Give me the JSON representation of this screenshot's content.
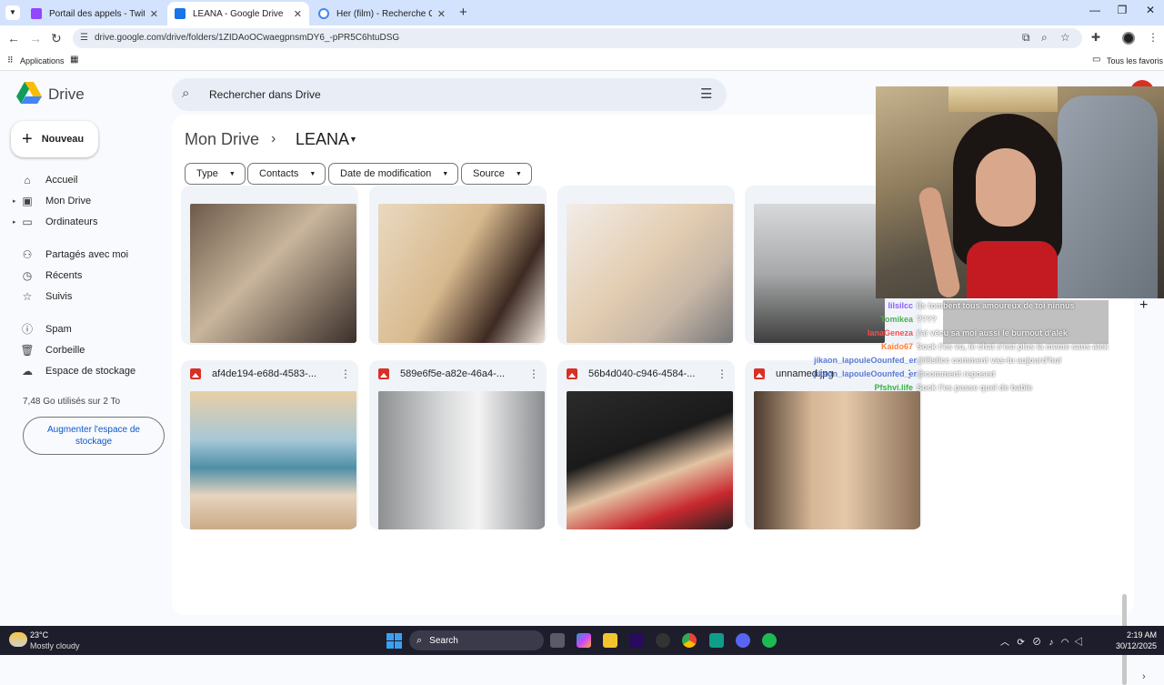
{
  "browser": {
    "tabs": [
      {
        "title": "Portail des appels - Twitch",
        "color": "#9146ff"
      },
      {
        "title": "LEANA - Google Drive",
        "color": "#1a73e8"
      },
      {
        "title": "Her (film) - Recherche Google",
        "color": "#4285f4"
      }
    ],
    "url": "drive.google.com/drive/folders/1ZIDAoOCwaegpnsmDY6_-pPR5C6htuDSG",
    "bookmarks": {
      "apps": "Applications",
      "all": "Tous les favoris"
    }
  },
  "drive": {
    "title": "Drive",
    "search_placeholder": "Rechercher dans Drive",
    "new_label": "Nouveau",
    "nav": [
      {
        "label": "Accueil",
        "icon": "home-icon"
      },
      {
        "label": "Mon Drive",
        "icon": "drive-icon"
      },
      {
        "label": "Ordinateurs",
        "icon": "computer-icon"
      },
      {
        "label": "Partagés avec moi",
        "icon": "people-icon"
      },
      {
        "label": "Récents",
        "icon": "clock-icon"
      },
      {
        "label": "Suivis",
        "icon": "star-icon"
      },
      {
        "label": "Spam",
        "icon": "spam-icon"
      },
      {
        "label": "Corbeille",
        "icon": "trash-icon"
      },
      {
        "label": "Espace de stockage",
        "icon": "cloud-icon"
      }
    ],
    "storage_text": "7,48 Go utilisés sur 2 To",
    "storage_button": "Augmenter l'espace de stockage",
    "breadcrumb": {
      "root": "Mon Drive",
      "current": "LEANA"
    },
    "filters": [
      "Type",
      "Contacts",
      "Date de modification",
      "Source"
    ],
    "files_bottom": [
      {
        "name": "af4de194-e68d-4583-..."
      },
      {
        "name": "589e6f5e-a82e-46a4-..."
      },
      {
        "name": "56b4d040-c946-4584-..."
      },
      {
        "name": "unnamed.jpg"
      }
    ]
  },
  "chat": [
    {
      "user": "lilsilcc",
      "msg": "ils tombent tous amoureux de toi ninnus",
      "color": "#8a5cff"
    },
    {
      "user": "Tomikea",
      "msg": "????",
      "color": "#4caf50"
    },
    {
      "user": "lanaGeneza",
      "msg": "j'ai vécu sa moi aussi le burnout d'alek",
      "color": "#ff4d4d"
    },
    {
      "user": "Kaido67",
      "msg": "Sock t'es vu, le chat s'est plus la meme sans alek",
      "color": "#ff7a33"
    },
    {
      "user": "jikaon_lapouleOounfed_er",
      "msg": "@lilsilcc comment vas-tu aujourd'hui",
      "color": "#5b7bd5"
    },
    {
      "user": "jikaon_lapouleOounfed_er",
      "msg": "@comment reposed",
      "color": "#5b7bd5"
    },
    {
      "user": "Pfshvi.life",
      "msg": "Sock t'es passe quel de bable",
      "color": "#3cb043"
    }
  ],
  "taskbar": {
    "temp": "23°C",
    "weather": "Mostly cloudy",
    "search": "Search",
    "time": "2:19 AM",
    "date": "30/12/2025"
  }
}
